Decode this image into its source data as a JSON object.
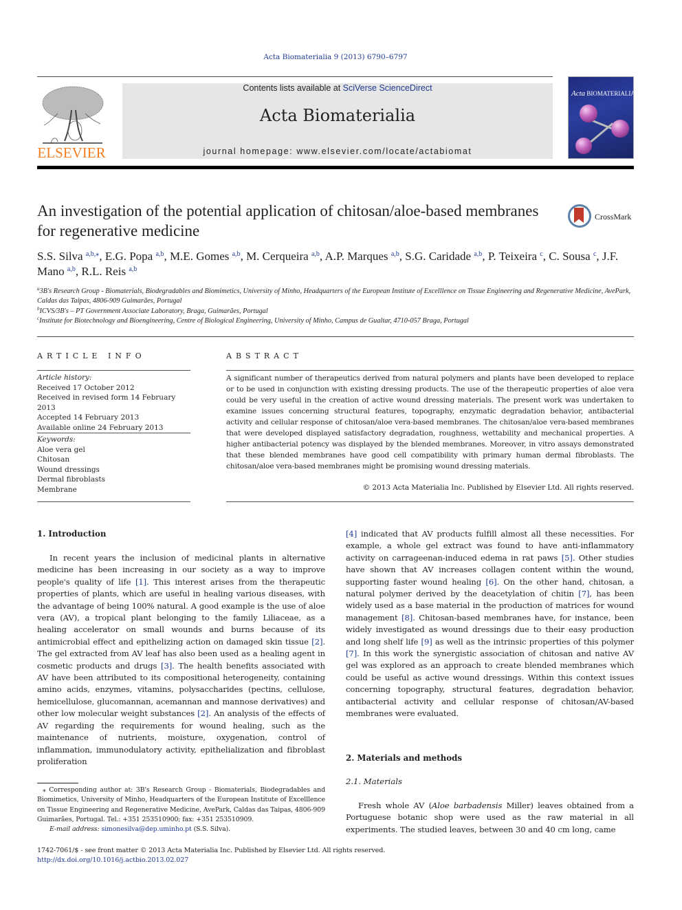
{
  "journal_ref": "Acta Biomaterialia 9 (2013) 6790–6797",
  "masthead": {
    "contents_prefix": "Contents lists available at ",
    "contents_link": "SciVerse ScienceDirect",
    "journal_name": "Acta Biomaterialia",
    "homepage_line": "journal homepage: www.elsevier.com/locate/actabiomat",
    "publisher_logo_text": "ELSEVIER",
    "cover_title_italic": "Acta",
    "cover_title_rest": "BIOMATERIALIA"
  },
  "colors": {
    "elsevier_orange": "#f37e20",
    "link_blue": "#1f3a93",
    "masthead_gray": "#e6e6e6",
    "crossmark_red": "#c0392b",
    "crossmark_ring": "#5b7fa8"
  },
  "crossmark": {
    "label": "CrossMark",
    "icon": "crossmark-icon"
  },
  "title": "An investigation of the potential application of chitosan/aloe-based membranes for regenerative medicine",
  "authors": [
    {
      "name": "S.S. Silva",
      "aff": "a,b,⁎"
    },
    {
      "name": "E.G. Popa",
      "aff": "a,b"
    },
    {
      "name": "M.E. Gomes",
      "aff": "a,b"
    },
    {
      "name": "M. Cerqueira",
      "aff": "a,b"
    },
    {
      "name": "A.P. Marques",
      "aff": "a,b"
    },
    {
      "name": "S.G. Caridade",
      "aff": "a,b"
    },
    {
      "name": "P. Teixeira",
      "aff": "c"
    },
    {
      "name": "C. Sousa",
      "aff": "c"
    },
    {
      "name": "J.F. Mano",
      "aff": "a,b"
    },
    {
      "name": "R.L. Reis",
      "aff": "a,b"
    }
  ],
  "affiliations": [
    {
      "key": "a",
      "text": "3B's Research Group - Biomaterials, Biodegradables and Biomimetics, University of Minho, Headquarters of the European Institute of Excelllence on Tissue Engineering and Regenerative Medicine, AvePark, Caldas das Taipas, 4806-909 Guimarães, Portugal"
    },
    {
      "key": "b",
      "text": "ICVS/3B's – PT Government Associate Laboratory, Braga, Guimarães, Portugal"
    },
    {
      "key": "c",
      "text": "Institute for Biotechnology and Bioengineering, Centre of Biological Engineering, University of Minho, Campus de Gualtar, 4710-057 Braga, Portugal"
    }
  ],
  "article_info": {
    "caption": "ARTICLE INFO",
    "history_label": "Article history:",
    "history": [
      "Received 17 October 2012",
      "Received in revised form 14 February 2013",
      "Accepted 14 February 2013",
      "Available online 24 February 2013"
    ],
    "keywords_label": "Keywords:",
    "keywords": [
      "Aloe vera gel",
      "Chitosan",
      "Wound dressings",
      "Dermal fibroblasts",
      "Membrane"
    ]
  },
  "abstract": {
    "caption": "ABSTRACT",
    "text": "A significant number of therapeutics derived from natural polymers and plants have been developed to replace or to be used in conjunction with existing dressing products. The use of the therapeutic properties of aloe vera could be very useful in the creation of active wound dressing materials. The present work was undertaken to examine issues concerning structural features, topography, enzymatic degradation behavior, antibacterial activity and cellular response of chitosan/aloe vera-based membranes. The chitosan/aloe vera-based membranes that were developed displayed satisfactory degradation, roughness, wettability and mechanical properties. A higher antibacterial potency was displayed by the blended membranes. Moreover, in vitro assays demonstrated that these blended membranes have good cell compatibility with primary human dermal fibroblasts. The chitosan/aloe vera-based membranes might be promising wound dressing materials.",
    "copyright": "© 2013 Acta Materialia Inc. Published by Elsevier Ltd. All rights reserved."
  },
  "body": {
    "intro_heading": "1. Introduction",
    "intro_p1": [
      {
        "t": "In recent years the inclusion of medicinal plants in alternative medicine has been increasing in our society as a way to improve people's quality of life "
      },
      {
        "ref": "[1]"
      },
      {
        "t": ". This interest arises from the therapeutic properties of plants, which are useful in healing various diseases, with the advantage of being 100% natural. A good example is the use of aloe vera (AV), a tropical plant belonging to the family Liliaceae, as a healing accelerator on small wounds and burns because of its antimicrobial effect and epithelizing action on damaged skin tissue "
      },
      {
        "ref": "[2]"
      },
      {
        "t": ". The gel extracted from AV leaf has also been used as a healing agent in cosmetic products and drugs "
      },
      {
        "ref": "[3]"
      },
      {
        "t": ". The health benefits associated with AV have been attributed to its compositional heterogeneity, containing amino acids, enzymes, vitamins, polysaccharides (pectins, cellulose, hemicellulose, glucomannan, acemannan and mannose derivatives) and other low molecular weight substances "
      },
      {
        "ref": "[2]"
      },
      {
        "t": ". An analysis of the effects of AV regarding the requirements for wound healing, such as the maintenance of nutrients, moisture, oxygenation, control of inflammation, immunodulatory activity, epithelialization and fibroblast proliferation"
      }
    ],
    "intro_p1_cont": [
      {
        "ref": "[4]"
      },
      {
        "t": " indicated that AV products fulfill almost all these necessities. For example, a whole gel extract was found to have anti-inflammatory activity on carrageenan-induced edema in rat paws "
      },
      {
        "ref": "[5]"
      },
      {
        "t": ". Other studies have shown that AV increases collagen content within the wound, supporting faster wound healing "
      },
      {
        "ref": "[6]"
      },
      {
        "t": ". On the other hand, chitosan, a natural polymer derived by the deacetylation of chitin "
      },
      {
        "ref": "[7]"
      },
      {
        "t": ", has been widely used as a base material in the production of matrices for wound management "
      },
      {
        "ref": "[8]"
      },
      {
        "t": ". Chitosan-based membranes have, for instance, been widely investigated as wound dressings due to their easy production and long shelf life "
      },
      {
        "ref": "[9]"
      },
      {
        "t": " as well as the intrinsic properties of this polymer "
      },
      {
        "ref": "[7]"
      },
      {
        "t": ". In this work the synergistic association of chitosan and native AV gel was explored as an approach to create blended membranes which could be useful as active wound dressings. Within this context issues concerning topography, structural features, degradation behavior, antibacterial activity and cellular response of chitosan/AV-based membranes were evaluated."
      }
    ],
    "mm_heading": "2. Materials and methods",
    "materials_heading": "2.1. Materials",
    "materials_p1": [
      {
        "t": "Fresh whole AV ("
      },
      {
        "i": "Aloe barbadensis"
      },
      {
        "t": " Miller) leaves obtained from a Portuguese botanic shop were used as the raw material in all experiments. The studied leaves, between 30 and 40 cm long, came"
      }
    ]
  },
  "footnote": {
    "marker": "⁎",
    "corresponding": "Corresponding author at: 3B's Research Group - Biomaterials, Biodegradables and Biomimetics, University of Minho, Headquarters of the European Institute of Excelllence on Tissue Engineering and Regenerative Medicine, AvePark, Caldas das Taipas, 4806-909 Guimarães, Portugal. Tel.: +351 253510900; fax: +351 253510909.",
    "email_label": "E-mail address:",
    "email": "simonesilva@dep.uminho.pt",
    "email_suffix": " (S.S. Silva)."
  },
  "bottom": {
    "issn_line": "1742-7061/$ - see front matter © 2013 Acta Materialia Inc. Published by Elsevier Ltd. All rights reserved.",
    "doi": "http://dx.doi.org/10.1016/j.actbio.2013.02.027"
  }
}
